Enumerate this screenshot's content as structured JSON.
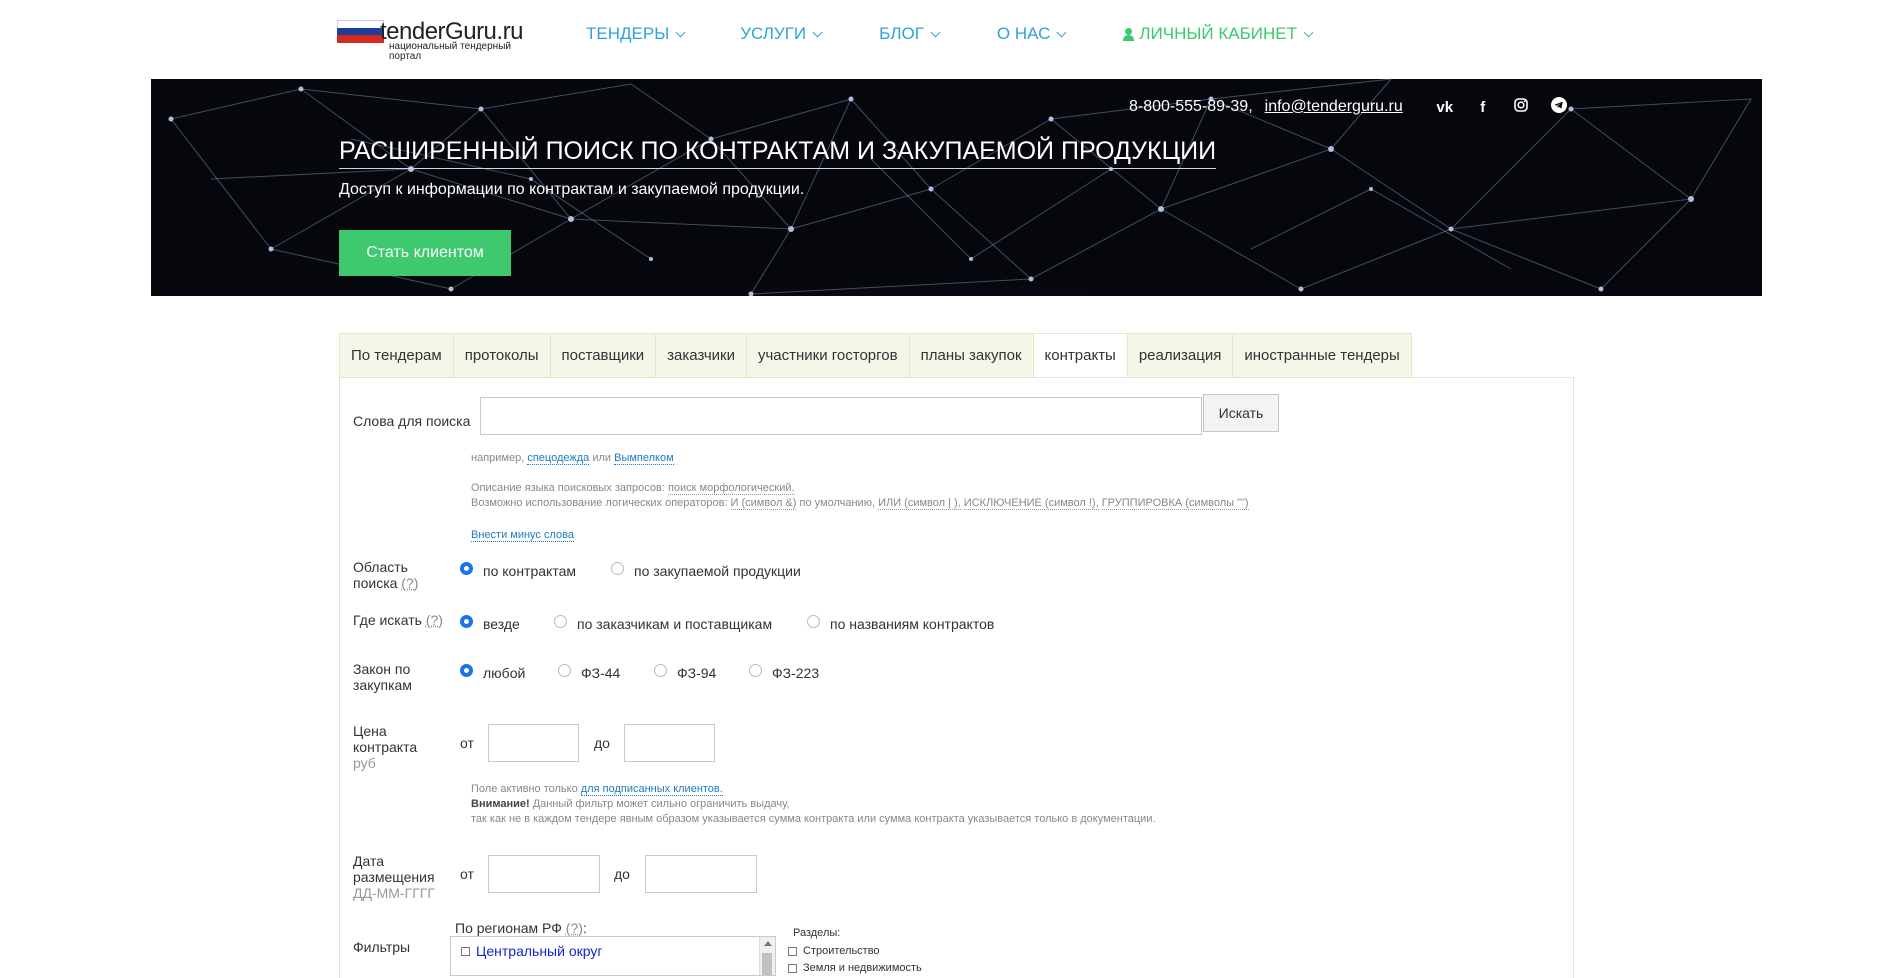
{
  "brand": {
    "name": "tenderGuru.ru",
    "tagline": "национальный тендерный портал"
  },
  "nav": {
    "items": [
      "ТЕНДЕРЫ",
      "УСЛУГИ",
      "БЛОГ",
      "О НАС"
    ],
    "cabinet": "ЛИЧНЫЙ КАБИНЕТ"
  },
  "hero": {
    "phone": "8-800-555-89-39,",
    "email": "info@tenderguru.ru",
    "social": [
      "vk-icon",
      "facebook-icon",
      "instagram-icon",
      "telegram-icon"
    ],
    "title": "РАСШИРЕННЫЙ ПОИСК ПО КОНТРАКТАМ И ЗАКУПАЕМОЙ ПРОДУКЦИИ",
    "subtitle": "Доступ к информации по контрактам и закупаемой продукции.",
    "cta": "Стать клиентом"
  },
  "tabs": [
    "По тендерам",
    "протоколы",
    "поставщики",
    "заказчики",
    "участники госторгов",
    "планы закупок",
    "контракты",
    "реализация",
    "иностранные тендеры"
  ],
  "active_tab": "контракты",
  "form": {
    "search_label": "Слова для поиска",
    "search_value": "",
    "search_button": "Искать",
    "example_prefix": "например,",
    "example_1": "спецодежда",
    "example_or": "или",
    "example_2": "Вымпелком",
    "lang_desc_prefix": "Описание языка поисковых запросов:",
    "lang_desc_link": "поиск морфологический.",
    "ops_prefix": "Возможно использование логических операторов:",
    "op_and": "И (символ &)",
    "op_default": "по умолчанию,",
    "op_or": "ИЛИ (символ | ),",
    "op_not": "ИСКЛЮЧЕНИЕ (символ !),",
    "op_group": "ГРУППИРОВКА (символы \"\")",
    "minus_words": "Внести минус слова",
    "area_label_1": "Область",
    "area_label_2": "поиска",
    "q_mark": "(?)",
    "area_options": [
      "по контрактам",
      "по закупаемой продукции"
    ],
    "where_label": "Где искать",
    "where_options": [
      "везде",
      "по заказчикам и поставщикам",
      "по названиям контрактов"
    ],
    "law_label_1": "Закон по",
    "law_label_2": "закупкам",
    "law_options": [
      "любой",
      "ФЗ-44",
      "ФЗ-94",
      "ФЗ-223"
    ],
    "price_label_1": "Цена",
    "price_label_2": "контракта",
    "price_unit": "руб",
    "from": "от",
    "to": "до",
    "price_note_prefix": "Поле активно только",
    "price_note_link": "для подписанных клиентов.",
    "attention": "Внимание!",
    "attention_text": "Данный фильтр может сильно ограничить выдачу,",
    "attention_text_2": "так как не в каждом тендере явным образом указывается сумма контракта или сумма контракта указывается только в документации.",
    "date_label_1": "Дата",
    "date_label_2": "размещения",
    "date_format": "ДД-ММ-ГГГГ",
    "filters_label": "Фильтры",
    "regions_label": "По регионам РФ",
    "region_item": "Центральный округ",
    "sections_label": "Разделы:",
    "sections": [
      "Строительство",
      "Земля и недвижимость"
    ]
  }
}
